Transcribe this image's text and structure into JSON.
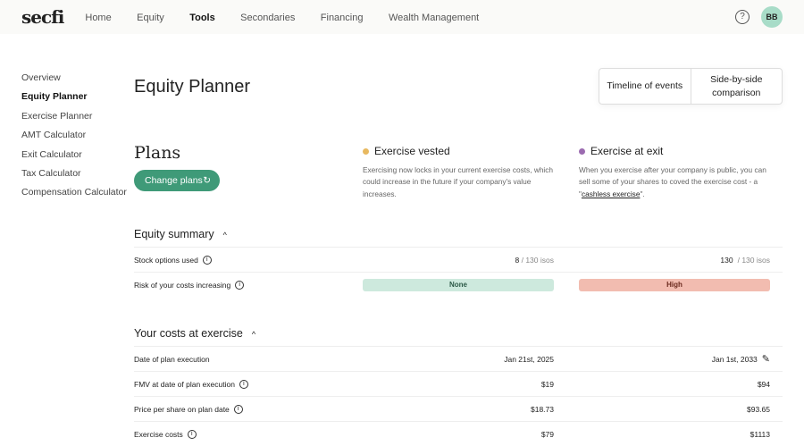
{
  "nav": {
    "logo": "secfi",
    "items": [
      "Home",
      "Equity",
      "Tools",
      "Secondaries",
      "Financing",
      "Wealth Management"
    ],
    "help": "?",
    "avatar": "BB"
  },
  "sidebar": [
    "Overview",
    "Equity Planner",
    "Exercise Planner",
    "AMT Calculator",
    "Exit Calculator",
    "Tax Calculator",
    "Compensation Calculator"
  ],
  "title": "Equity Planner",
  "view_toggle": {
    "timeline": "Timeline of events",
    "side": "Side-by-side comparison"
  },
  "plans": {
    "title": "Plans",
    "change": "Change plans",
    "change_icon": "↻"
  },
  "vested": {
    "title": "Exercise vested",
    "desc": "Exercising now locks in your current exercise costs, which could increase in the future if your company's value increases.",
    "color": "#e8b960"
  },
  "exit": {
    "title": "Exercise at exit",
    "desc_pre": "When you exercise after your company is public, you can sell some of your shares to coved the exercise cost - a \"",
    "link": "cashless exercise",
    "desc_post": "\".",
    "color": "#9b6bb0"
  },
  "equity_summary": {
    "title": "Equity summary",
    "rows": {
      "options": {
        "label": "Stock options used",
        "v1": "8",
        "v2": "130",
        "of": "/ 130 isos"
      },
      "risk": {
        "label": "Risk of your costs increasing",
        "v1": "None",
        "v2": "High"
      }
    }
  },
  "costs": {
    "title": "Your costs at exercise",
    "rows": [
      {
        "label": "Date of plan execution",
        "v1": "Jan 21st, 2025",
        "v2": "Jan 1st, 2033"
      },
      {
        "label": "FMV at date of plan execution",
        "v1": "$19",
        "v2": "$94"
      },
      {
        "label": "Price per share on plan date",
        "v1": "$18.73",
        "v2": "$93.65"
      },
      {
        "label": "Exercise costs",
        "v1": "$79",
        "v2": "$1113"
      }
    ]
  }
}
